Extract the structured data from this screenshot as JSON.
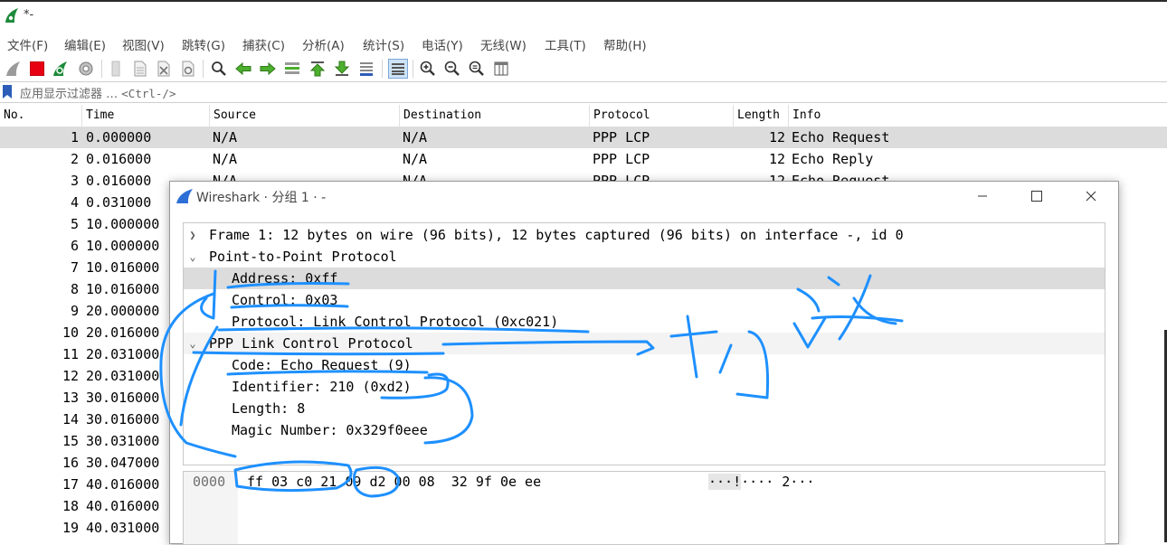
{
  "window": {
    "title": "*-"
  },
  "menu": [
    "文件(F)",
    "编辑(E)",
    "视图(V)",
    "跳转(G)",
    "捕获(C)",
    "分析(A)",
    "统计(S)",
    "电话(Y)",
    "无线(W)",
    "工具(T)",
    "帮助(H)"
  ],
  "filter": {
    "placeholder": "应用显示过滤器 …",
    "shortcut": "<Ctrl-/>"
  },
  "columns": [
    "No.",
    "Time",
    "Source",
    "Destination",
    "Protocol",
    "Length",
    "Info"
  ],
  "packets": [
    {
      "no": "1",
      "time": "0.000000",
      "src": "N/A",
      "dst": "N/A",
      "proto": "PPP LCP",
      "len": "12",
      "info": "Echo Request"
    },
    {
      "no": "2",
      "time": "0.016000",
      "src": "N/A",
      "dst": "N/A",
      "proto": "PPP LCP",
      "len": "12",
      "info": "Echo Reply"
    },
    {
      "no": "3",
      "time": "0.016000",
      "src": "N/A",
      "dst": "N/A",
      "proto": "PPP LCP",
      "len": "12",
      "info": "Echo Request"
    },
    {
      "no": "4",
      "time": "0.031000"
    },
    {
      "no": "5",
      "time": "10.000000"
    },
    {
      "no": "6",
      "time": "10.000000"
    },
    {
      "no": "7",
      "time": "10.016000"
    },
    {
      "no": "8",
      "time": "10.016000"
    },
    {
      "no": "9",
      "time": "20.000000"
    },
    {
      "no": "10",
      "time": "20.016000"
    },
    {
      "no": "11",
      "time": "20.031000"
    },
    {
      "no": "12",
      "time": "20.031000"
    },
    {
      "no": "13",
      "time": "30.016000"
    },
    {
      "no": "14",
      "time": "30.016000"
    },
    {
      "no": "15",
      "time": "30.031000"
    },
    {
      "no": "16",
      "time": "30.047000"
    },
    {
      "no": "17",
      "time": "40.016000"
    },
    {
      "no": "18",
      "time": "40.016000"
    },
    {
      "no": "19",
      "time": "40.031000"
    }
  ],
  "dialog": {
    "title": "Wireshark · 分组 1 · -",
    "tree": [
      "Frame 1: 12 bytes on wire (96 bits), 12 bytes captured (96 bits) on interface -, id 0",
      "Point-to-Point Protocol",
      "Address: 0xff",
      "Control: 0x03",
      "Protocol: Link Control Protocol (0xc021)",
      "PPP Link Control Protocol",
      "Code: Echo Request (9)",
      "Identifier: 210 (0xd2)",
      "Length: 8",
      "Magic Number: 0x329f0eee"
    ],
    "hex": {
      "offset": "0000",
      "bytes": "ff 03 c0 21 09 d2 00 08  32 9f 0e ee",
      "ascii_highlight": "···!",
      "ascii_rest": "···· 2···"
    }
  },
  "colors": {
    "selection": "#dcdcdc",
    "annotation_ink": "#1e90ff",
    "stop_button": "#e60012",
    "shark_fin": "#1c8a3a"
  }
}
